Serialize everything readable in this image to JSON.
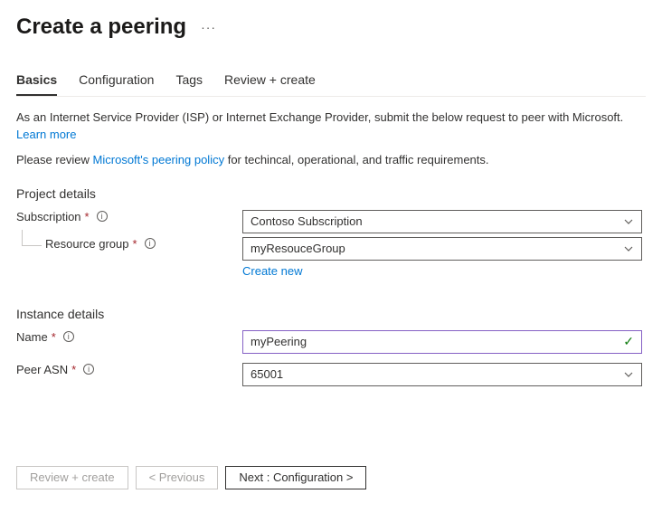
{
  "header": {
    "title": "Create a peering"
  },
  "tabs": [
    {
      "label": "Basics",
      "active": true
    },
    {
      "label": "Configuration",
      "active": false
    },
    {
      "label": "Tags",
      "active": false
    },
    {
      "label": "Review + create",
      "active": false
    }
  ],
  "intro": {
    "text": "As an Internet Service Provider (ISP) or Internet Exchange Provider, submit the below request to peer with Microsoft.",
    "learn_more": "Learn more"
  },
  "policy_note": {
    "prefix": "Please review ",
    "link": "Microsoft's peering policy",
    "suffix": " for techincal, operational, and traffic requirements."
  },
  "project": {
    "section_title": "Project details",
    "subscription_label": "Subscription",
    "subscription_value": "Contoso Subscription",
    "resource_group_label": "Resource group",
    "resource_group_value": "myResouceGroup",
    "create_new": "Create new"
  },
  "instance": {
    "section_title": "Instance details",
    "name_label": "Name",
    "name_value": "myPeering",
    "peer_asn_label": "Peer ASN",
    "peer_asn_value": "65001"
  },
  "footer": {
    "review_create": "Review + create",
    "previous": "< Previous",
    "next": "Next : Configuration >"
  }
}
